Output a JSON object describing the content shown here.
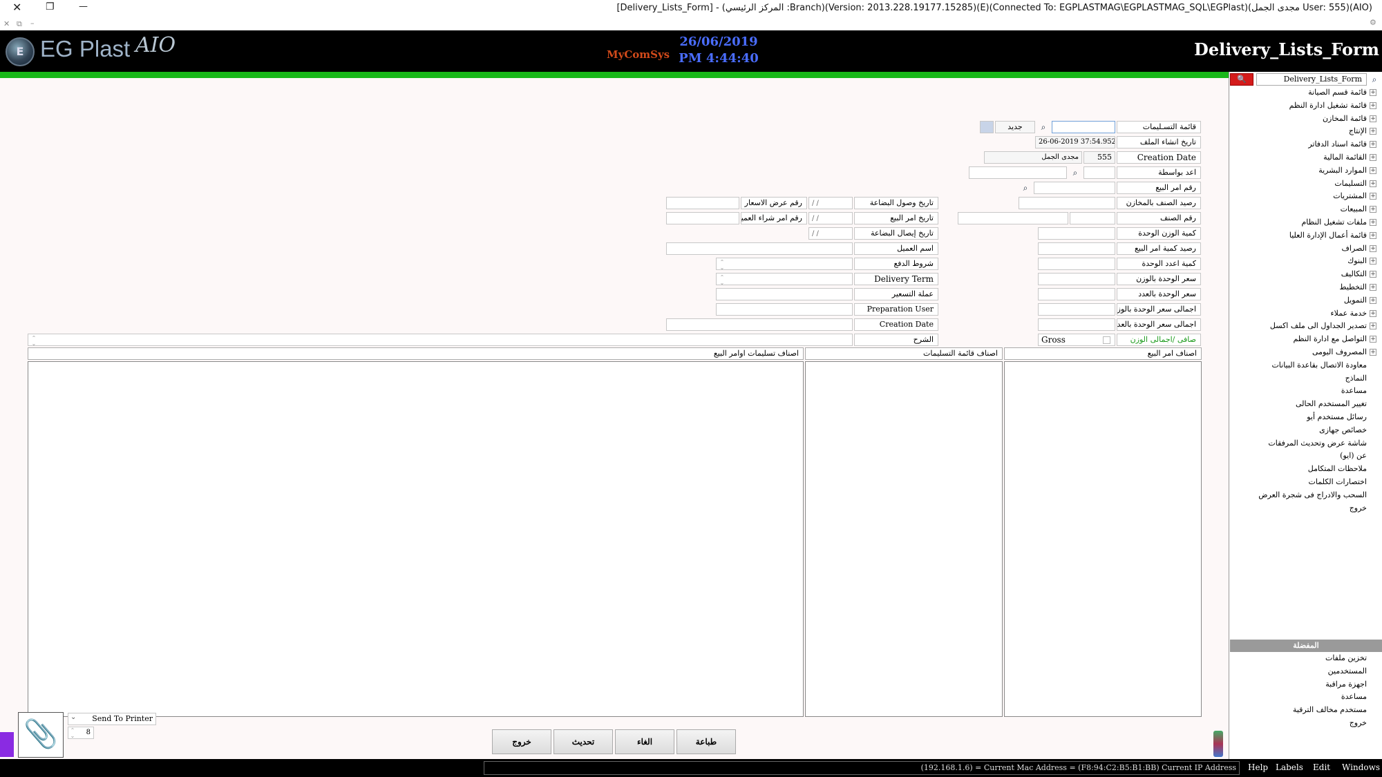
{
  "window": {
    "title": "[Delivery_Lists_Form] - (المركز الرئيسي :Branch)(Version: 2013.228.19177.15285)(E)(Connected To: EGPLASTMAG\\EGPLASTMAG_SQL\\EGPlast)(مجدى الجمل User: 555)(AIO)",
    "close_glyph": "✕",
    "restore_glyph": "❐",
    "minimize_glyph": "—",
    "sub_close_glyph": "✕",
    "sub_restore_glyph": "⧉",
    "sub_minimize_glyph": "–",
    "right_glyph": "⚙"
  },
  "header": {
    "logo_mark": "E",
    "logo_text": "EG Plast",
    "logo_script": "AIO",
    "brand_mid": "MyComSys",
    "date": "26/06/2019",
    "time": "PM 4:44:40",
    "form_name": "Delivery_Lists_Form",
    "accent_color": "#19b819"
  },
  "tree": {
    "search_value": "Delivery_Lists_Form",
    "items": [
      "قائمة قسم الصيانة",
      "قائمة تشغيل ادارة النظم",
      "قائمة المخازن",
      "الإنتاج",
      "قائمة اسناد الدفاتر",
      "القائمة المالية",
      "الموارد البشرية",
      "التسليمات",
      "المشتريات",
      "المبيعات",
      "ملفات تشغيل النظام",
      "قائمة أعمال الإدارة العليا",
      "الصراف",
      "البنوك",
      "التكاليف",
      "التخطيط",
      "التمويل",
      "خدمة عملاء",
      "تصدير الجداول الى ملف اكسل",
      "التواصل مع ادارة النظم",
      "المصروف اليومى",
      "معاودة الاتصال بقاعدة البيانات",
      "النماذج",
      "مساعدة",
      "تغيير المستخدم الحالى",
      "رسائل مستخدم أيو",
      "خصائص جهازى",
      "شاشة عرض وتحديث المرفقات",
      "عن (ايو)",
      "ملاحظات المتكامل",
      "اختصارات الكلمات",
      "السحب والادراج فى شجرة العرض",
      "خروج"
    ],
    "favorites_header": "المفضلة",
    "favorites": [
      "تخزين ملفات",
      "المستخدمين",
      "اجهزة مراقبة",
      "مساعدة",
      "مستخدم مخالف الترقية",
      "خروج"
    ]
  },
  "form": {
    "delivery_list_label": "قائمة التسـليمات",
    "new_button": "جديد",
    "file_date_label": "تاريخ انشاء الملف",
    "file_date_value": "26-06-2019 37:54.952",
    "creation_date_label": "Creation Date",
    "user_id": "555",
    "user_name": "مجدى الجمل",
    "prepared_by_label": "اعد بواسطة",
    "sales_order_label": "رقم امر البيع",
    "stock_balance_label": "رصيد الصنف بالمخازن",
    "item_no_label": "رقم الصنف",
    "unit_weight_qty_label": "كمية الوزن الوحدة",
    "sales_qty_balance_label": "رصيد كمية امر البيع",
    "unit_count_qty_label": "كمية اعدد الوحدة",
    "unit_weight_price_label": "سعر الوحدة بالوزن",
    "unit_count_price_label": "سعر الوحدة بالعدد",
    "total_weight_price_label": "اجمالى سعر الوحدة بالوز",
    "total_count_price_label": "اجمالى سعر الوحدة بالعدد",
    "net_gross_label": "صافى /اجمالى الوزن",
    "gross_text": "Gross",
    "goods_arrival_date_label": "تاريخ وصول البضاعة",
    "sales_order_date_label": "تاريخ امر البيع",
    "delivery_receipt_date_label": "تاريخ إيصال البضاعة",
    "customer_name_label": "اسم العميل",
    "payment_terms_label": "شروط الدفع",
    "delivery_term_label": "Delivery Term",
    "pricing_currency_label": "عملة التسعير",
    "preparation_user_label": "Preparation User",
    "creation_date2_label": "Creation Date",
    "notes_label": "الشرح",
    "quotation_no_label": "رقم عرض الاسعار",
    "customer_po_label": "رقم امر شراء العميل",
    "date_placeholder": "/ /"
  },
  "grids": {
    "sales_order_items": "اصناف امر البيع",
    "delivery_list_items": "اصناف قائمة التسليمات",
    "delivered_items": "اصناف تسليمات اوامر البيع"
  },
  "bottom": {
    "print_button": "طباعة",
    "cancel_button": "الغاء",
    "update_button": "تحديث",
    "exit_button": "خروج",
    "printer_select": "Send To Printer",
    "copies": "8",
    "attach_glyph": "📎"
  },
  "status": {
    "ip_text": "(192.168.1.6) = Current Mac Address = (F8:94:C2:B5:B1:BB) Current IP Address",
    "menu": [
      "Help",
      "Labels",
      "Edit",
      "Windows"
    ]
  }
}
